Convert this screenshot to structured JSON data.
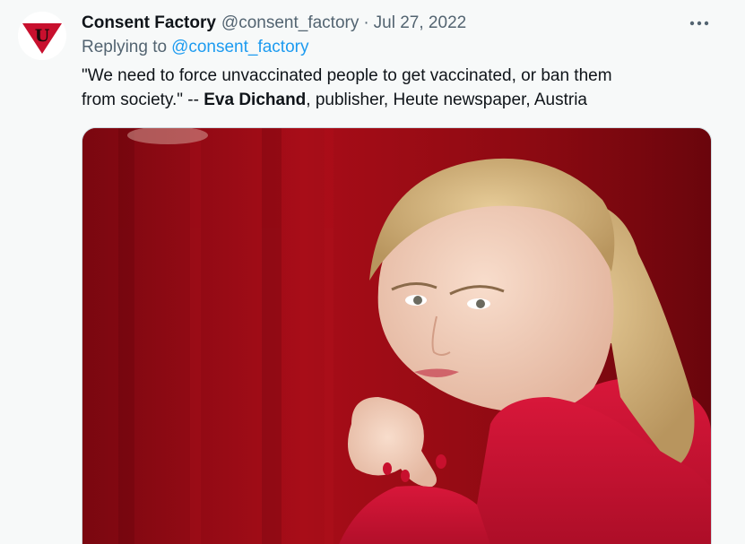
{
  "tweet": {
    "display_name": "Consent Factory",
    "handle": "@consent_factory",
    "separator": "·",
    "timestamp": "Jul 27, 2022",
    "replying_prefix": "Replying to",
    "replying_to": "@consent_factory",
    "text_line1": "\"We need to force unvaccinated people to get vaccinated, or ban them",
    "text_line2_prefix": "from society.\" -- ",
    "text_bold": "Eva Dichand",
    "text_line2_suffix": ", publisher, Heute newspaper, Austria",
    "avatar_letter": "U",
    "more_icon": "more-horizontal-icon",
    "media": {
      "description_icon": "photo",
      "colors": {
        "background": "#9b0c16",
        "sweater": "#c8102e",
        "hair": "#d8b985",
        "skin": "#f2d0bd"
      }
    }
  },
  "colors": {
    "secondary_text": "#536471",
    "link": "#1d9bf0",
    "avatar_red": "#c8102e"
  }
}
